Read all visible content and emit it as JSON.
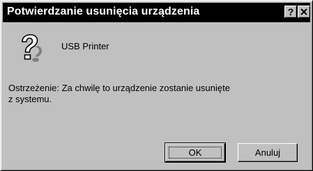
{
  "window": {
    "title": "Potwierdzanie usunięcia urządzenia",
    "help_button": "?",
    "close_button": "✕"
  },
  "dialog": {
    "icon": "question-mark-icon",
    "device_name": "USB Printer",
    "warning_line1": "Ostrzeżenie: Za chwilę to urządzenie zostanie usunięte",
    "warning_line2": "z systemu."
  },
  "buttons": {
    "ok_label": "OK",
    "cancel_label": "Anuluj"
  },
  "colors": {
    "titlebar": "#000000",
    "title_text": "#ffffff",
    "face": "#c0c0c0"
  }
}
